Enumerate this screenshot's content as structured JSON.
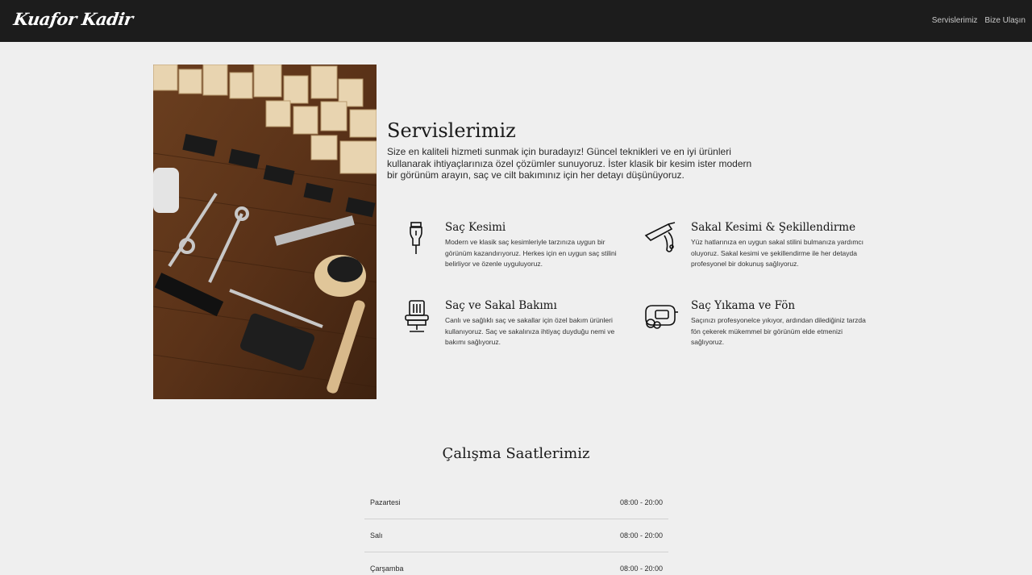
{
  "nav": {
    "brand": "Kuafor Kadir",
    "links": [
      "Servislerimiz",
      "Bize Ulaşın"
    ]
  },
  "services": {
    "title": "Servislerimiz",
    "intro": "Size en kaliteli hizmeti sunmak için buradayız! Güncel teknikleri ve en iyi ürünleri kullanarak ihtiyaçlarınıza özel çözümler sunuyoruz. İster klasik bir kesim ister modern bir görünüm arayın, saç ve cilt bakımınız için her detayı düşünüyoruz.",
    "items": [
      {
        "icon": "clipper-icon",
        "title": "Saç Kesimi",
        "desc": "Modern ve klasik saç kesimleriyle tarzınıza uygun bir görünüm kazandırıyoruz. Herkes için en uygun saç stilini belirliyor ve özenle uyguluyoruz."
      },
      {
        "icon": "razor-icon",
        "title": "Sakal Kesimi & Şekillendirme",
        "desc": "Yüz hatlarınıza en uygun sakal stilini bulmanıza yardımcı oluyoruz. Sakal kesimi ve şekillendirme ile her detayda profesyonel bir dokunuş sağlıyoruz."
      },
      {
        "icon": "barber-chair-icon",
        "title": "Saç ve Sakal Bakımı",
        "desc": "Canlı ve sağlıklı saç ve sakallar için özel bakım ürünleri kullanıyoruz. Saç ve sakalınıza ihtiyaç duyduğu nemi ve bakımı sağlıyoruz."
      },
      {
        "icon": "hair-dryer-icon",
        "title": "Saç Yıkama ve Fön",
        "desc": "Saçınızı profesyonelce yıkıyor, ardından dilediğiniz tarzda fön çekerek mükemmel bir görünüm elde etmenizi sağlıyoruz."
      }
    ]
  },
  "hours": {
    "title": "Çalışma Saatlerimiz",
    "rows": [
      {
        "day": "Pazartesi",
        "time": "08:00 - 20:00"
      },
      {
        "day": "Salı",
        "time": "08:00 - 20:00"
      },
      {
        "day": "Çarşamba",
        "time": "08:00 - 20:00"
      }
    ]
  },
  "colors": {
    "navbar": "#1c1c1c",
    "background": "#efefef",
    "text": "#1e1e1e"
  }
}
